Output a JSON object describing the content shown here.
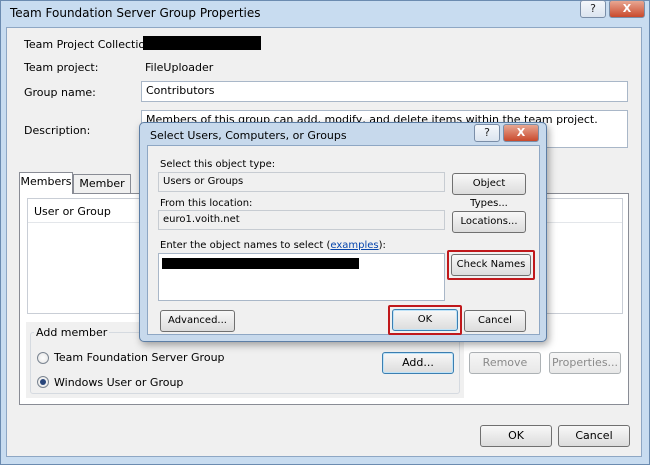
{
  "outer": {
    "title": "Team Foundation Server Group Properties",
    "help_glyph": "?",
    "close_glyph": "X",
    "labels": {
      "collection": "Team Project Collection:",
      "project": "Team project:",
      "group_name": "Group name:",
      "description": "Description:"
    },
    "values": {
      "project": "FileUploader",
      "group_name": "Contributors",
      "description": "Members of this group can add, modify, and delete items within the team project."
    },
    "tabs": [
      {
        "label": "Members"
      },
      {
        "label": "Member of"
      }
    ],
    "members_column": "User or Group",
    "add_member": {
      "legend": "Add member",
      "options": [
        {
          "label": "Team Foundation Server Group",
          "selected": false
        },
        {
          "label": "Windows User or Group",
          "selected": true
        }
      ],
      "add_button": "Add..."
    },
    "buttons": {
      "remove": "Remove",
      "properties": "Properties...",
      "ok": "OK",
      "cancel": "Cancel"
    }
  },
  "dialog": {
    "title": "Select Users, Computers, or Groups",
    "help_glyph": "?",
    "close_glyph": "X",
    "object_type_label": "Select this object type:",
    "object_type_value": "Users or Groups",
    "object_types_button": "Object Types...",
    "location_label": "From this location:",
    "location_value": "euro1.voith.net",
    "locations_button": "Locations...",
    "names_label_prefix": "Enter the object names to select (",
    "names_label_link": "examples",
    "names_label_suffix": "):",
    "check_names_button": "Check Names",
    "advanced_button": "Advanced...",
    "ok_button": "OK",
    "cancel_button": "Cancel"
  },
  "colors": {
    "highlight": "#c0181b",
    "link": "#0645ad",
    "title_bar": "#c8dcf0"
  }
}
